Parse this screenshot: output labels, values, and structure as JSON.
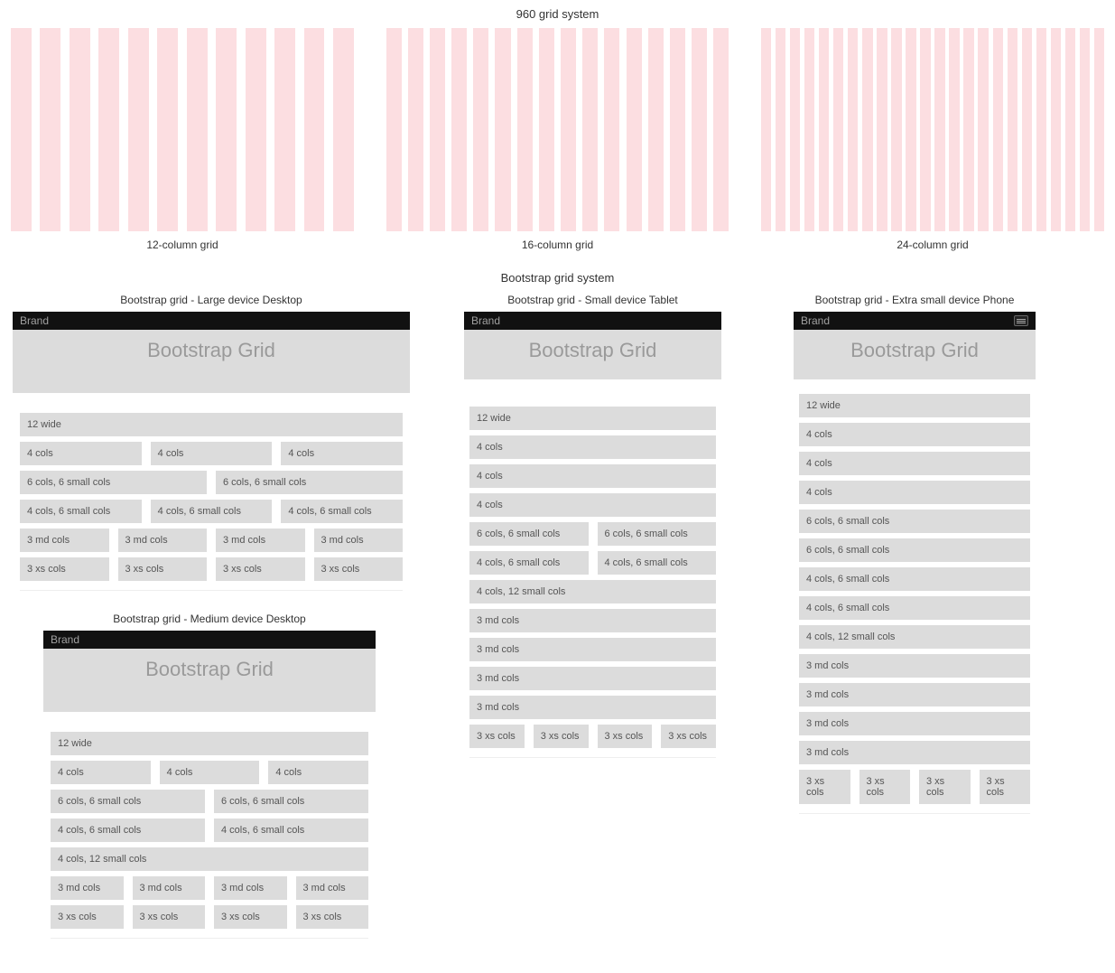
{
  "section960": {
    "title": "960 grid system",
    "grids": [
      {
        "columns": 12,
        "caption": "12-column grid"
      },
      {
        "columns": 16,
        "caption": "16-column grid"
      },
      {
        "columns": 24,
        "caption": "24-column grid"
      }
    ]
  },
  "bootstrap": {
    "title": "Bootstrap grid system",
    "brand": "Brand",
    "jumbo": "Bootstrap Grid",
    "labels": {
      "w12": "12 wide",
      "c4": "4 cols",
      "c6s6": "6 cols, 6 small cols",
      "c4s6": "4 cols, 6 small cols",
      "c4s12": "4 cols, 12 small cols",
      "md3": "3 md cols",
      "xs3": "3 xs cols"
    },
    "panels": {
      "lg": {
        "caption": "Bootstrap grid - Large device Desktop",
        "hamburger": false
      },
      "md": {
        "caption": "Bootstrap grid - Medium device Desktop",
        "hamburger": false
      },
      "sm": {
        "caption": "Bootstrap grid - Small device Tablet",
        "hamburger": false
      },
      "xs": {
        "caption": "Bootstrap grid - Extra small device Phone",
        "hamburger": true
      }
    }
  }
}
